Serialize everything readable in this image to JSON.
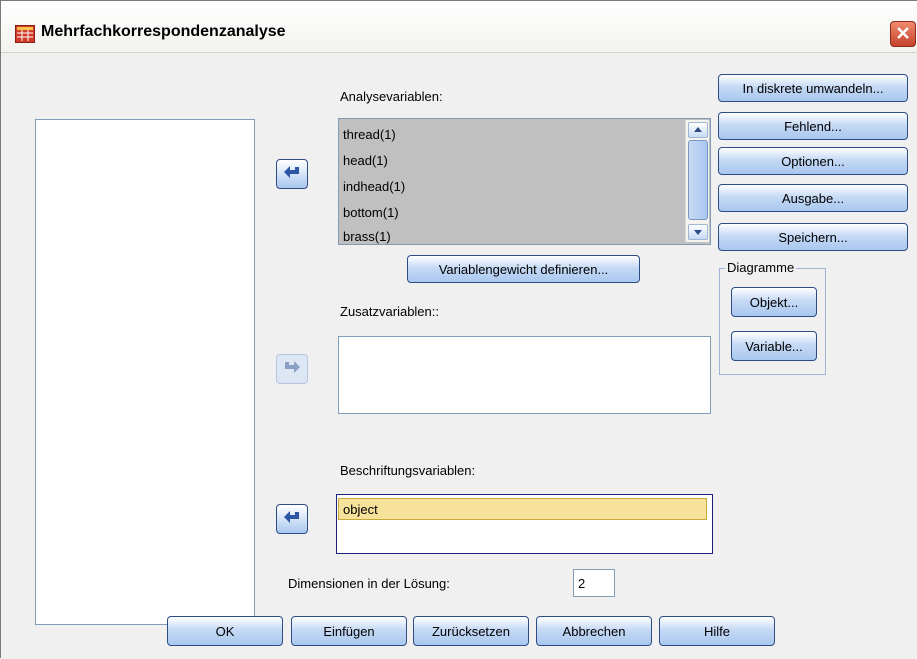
{
  "window": {
    "title": "Mehrfachkorrespondenzanalyse"
  },
  "left_list": {
    "items": []
  },
  "analysis": {
    "label": "Analysevariablen:",
    "items": [
      "thread(1)",
      "head(1)",
      "indhead(1)",
      "bottom(1)",
      "brass(1)"
    ]
  },
  "weight_button": "Variablengewicht definieren...",
  "supplementary": {
    "label": "Zusatzvariablen::",
    "items": []
  },
  "labeling": {
    "label": "Beschriftungsvariablen:",
    "items": [
      "object"
    ]
  },
  "dimensions": {
    "label": "Dimensionen in der Lösung:",
    "value": "2"
  },
  "side_buttons": {
    "discretize": "In diskrete umwandeln...",
    "missing": "Fehlend...",
    "options": "Optionen...",
    "output": "Ausgabe...",
    "save": "Speichern..."
  },
  "plots": {
    "label": "Diagramme",
    "object": "Objekt...",
    "variable": "Variable..."
  },
  "bottom_buttons": {
    "ok": "OK",
    "paste": "Einfügen",
    "reset": "Zurücksetzen",
    "cancel": "Abbrechen",
    "help": "Hilfe"
  },
  "colors": {
    "selection": "#c0c0c0",
    "highlight": "#f7e29b",
    "button_border": "#2d4c84",
    "arrow": "#2d55a5"
  }
}
